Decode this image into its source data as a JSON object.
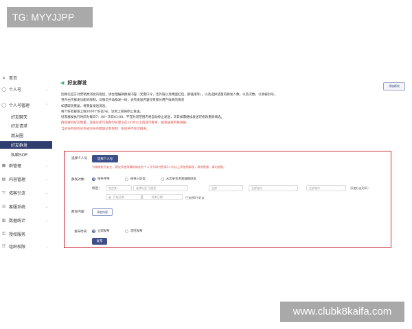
{
  "overlay": {
    "tg_label": "TG: MYYJJPP",
    "watermark": "www.clubk8kaifa.com"
  },
  "sidebar": {
    "items": [
      {
        "label": "首页",
        "icon": "home-icon",
        "glyph": "⌂"
      },
      {
        "label": "个人号",
        "icon": "user-icon",
        "glyph": "◯"
      },
      {
        "label": "个人号管理",
        "icon": "users-icon",
        "glyph": "◯"
      },
      {
        "label": "好友聊天"
      },
      {
        "label": "好友请求"
      },
      {
        "label": "朋友圈"
      },
      {
        "label": "好友群发"
      },
      {
        "label": "私聊SOP"
      },
      {
        "label": "群管理",
        "icon": "group-icon",
        "glyph": "▦"
      },
      {
        "label": "内容管理",
        "icon": "content-icon",
        "glyph": "▤"
      },
      {
        "label": "拓客引流",
        "icon": "funnel-icon",
        "glyph": "▽"
      },
      {
        "label": "客服系统",
        "icon": "headset-icon",
        "glyph": "☏"
      },
      {
        "label": "数据统计",
        "icon": "chart-icon",
        "glyph": "▥"
      },
      {
        "label": "授权服务",
        "icon": "key-icon",
        "glyph": "⚿"
      },
      {
        "label": "组织权限",
        "icon": "org-icon",
        "glyph": "☷"
      }
    ]
  },
  "main": {
    "title": "好友群发",
    "top_button": "添加群发",
    "notes": [
      {
        "text": "因微信官方对营销类消息的管控，请合理编辑群发内容（无需口令，无外链以及精图红包，群链接等），以及选择适量的群发人数，以及次数，以防被封号。",
        "red": false
      },
      {
        "text": "另外由于群发功能的限制，与微信手动群发一样，会有发送内容仅有部分用户收到的情况",
        "red": false
      },
      {
        "text": "如遇取消重复，将重复发送消息。",
        "red": false
      },
      {
        "text": "每个好友群发上限2000个好友/号，达到上限将停止发送。",
        "red": false
      },
      {
        "text": "好友群发执行时间为每日7：00~次日01:00，不在时间范围内将自动停止发送，次日如需继续发送可修改重新填选。",
        "red": false
      },
      {
        "text": "群组群的好友数量，该账号即可发群时长建议在1小时以上再选行群发，据发送将有格限报。",
        "red": true
      },
      {
        "text": "当前任务如有已完成的任务都超过有限制，系统将不会可群发。",
        "red": true
      }
    ],
    "form": {
      "account_label": "选择个人号",
      "account_button": "选择个人号",
      "account_hint": "为确保账号安全，建议须使用最新绑定的个人号号码并登录1小时以上再使用群发，群发数量，请勿超限。",
      "target_label": "群发对象：",
      "target_options": [
        {
          "label": "按条件筛",
          "checked": true
        },
        {
          "label": "按导入好友",
          "checked": false
        },
        {
          "label": "从历史任务获取群好友",
          "checked": false
        }
      ],
      "tag_label": "标签：",
      "tag_placeholder": "包含其一",
      "tag_select_placeholder": "选择标签 可搜索",
      "gender_value": "全部",
      "province_value": "全部省份",
      "city_value": "全部城市",
      "add_time_label": "添加好友时间：",
      "date_start": "开始日期",
      "date_to": "至",
      "date_end": "结束日期",
      "selected_count": "已选择0个好友",
      "content_label": "群发内容：",
      "content_button": "添加内容",
      "time_label": "发布时间",
      "time_options": [
        {
          "label": "立即发布",
          "checked": true
        },
        {
          "label": "定时发布",
          "checked": false
        }
      ],
      "submit": "发布"
    }
  }
}
